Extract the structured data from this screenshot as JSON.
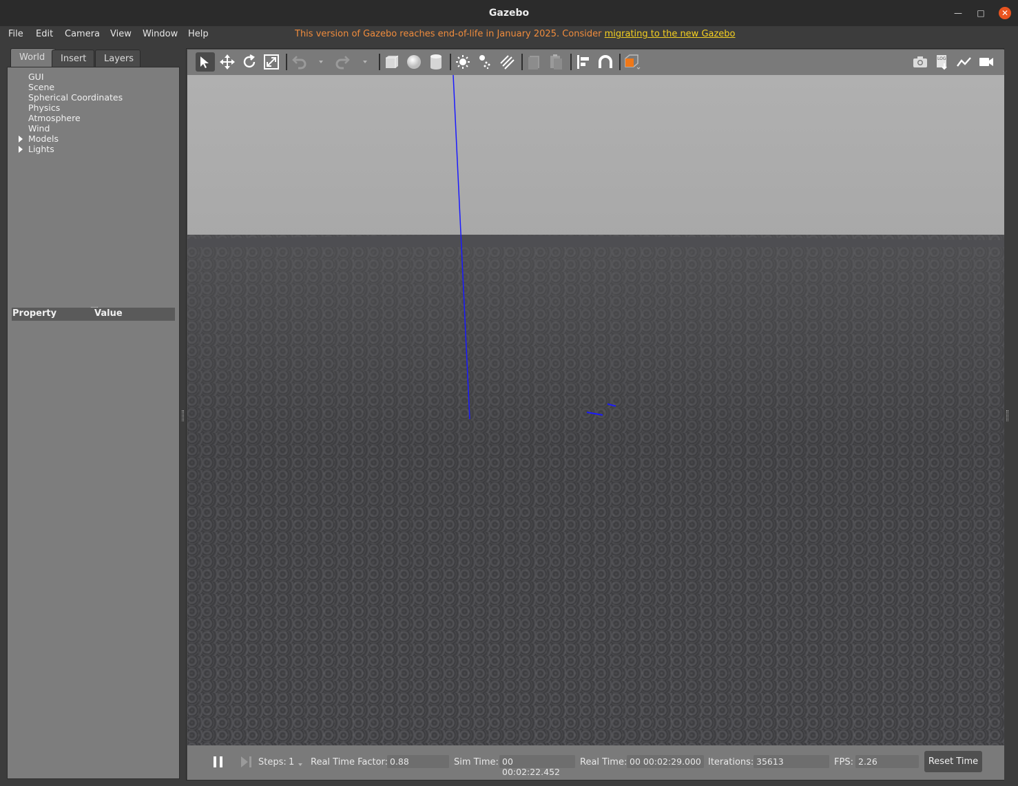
{
  "window": {
    "title": "Gazebo"
  },
  "menu": {
    "file": "File",
    "edit": "Edit",
    "camera": "Camera",
    "view": "View",
    "window": "Window",
    "help": "Help",
    "eol_text": "This version of Gazebo reaches end-of-life in January 2025. Consider ",
    "eol_link": "migrating to the new Gazebo"
  },
  "left_panel": {
    "tabs": [
      "World",
      "Insert",
      "Layers"
    ],
    "tree": [
      {
        "label": "GUI",
        "expandable": false
      },
      {
        "label": "Scene",
        "expandable": false
      },
      {
        "label": "Spherical Coordinates",
        "expandable": false
      },
      {
        "label": "Physics",
        "expandable": false
      },
      {
        "label": "Atmosphere",
        "expandable": false
      },
      {
        "label": "Wind",
        "expandable": false
      },
      {
        "label": "Models",
        "expandable": true
      },
      {
        "label": "Lights",
        "expandable": true
      }
    ],
    "property_header": {
      "property": "Property",
      "value": "Value"
    }
  },
  "toolbar": {
    "icons": [
      "select-mode-icon",
      "translate-mode-icon",
      "rotate-mode-icon",
      "scale-mode-icon",
      "undo-icon",
      "redo-icon",
      "box-icon",
      "sphere-icon",
      "cylinder-icon",
      "point-light-icon",
      "spot-light-icon",
      "directional-light-icon",
      "copy-icon",
      "paste-icon",
      "align-icon",
      "snap-icon",
      "view-angle-icon",
      "screenshot-icon",
      "log-icon",
      "plot-icon",
      "record-video-icon"
    ]
  },
  "statusbar": {
    "steps_label": "Steps:",
    "steps_value": "1",
    "rtf_label": "Real Time Factor:",
    "rtf_value": "0.88",
    "sim_time_label": "Sim Time:",
    "sim_time_value": "00 00:02:22.452",
    "real_time_label": "Real Time:",
    "real_time_value": "00 00:02:29.000",
    "iterations_label": "Iterations:",
    "iterations_value": "35613",
    "fps_label": "FPS:",
    "fps_value": "2.26",
    "reset_label": "Reset Time"
  },
  "colors": {
    "accent_close": "#e95420",
    "eol_text": "#f08c3c",
    "eol_link": "#f5d020",
    "axis_blue": "#1a1aff"
  }
}
